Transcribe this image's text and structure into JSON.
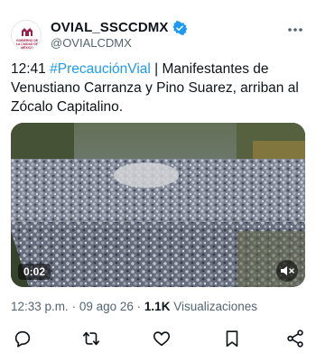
{
  "account": {
    "display_name": "OVIAL_SSCCDMX",
    "handle": "@OVIALCDMX",
    "logo_text": "GOBIERNO DE LA CIUDAD DE MÉXICO"
  },
  "tweet": {
    "time_prefix": "12:41 ",
    "hashtag": "#PrecauciónVial",
    "body": " | Manifestantes de Venustiano Carranza y Pino Suarez, arriban al Zócalo Capitalino."
  },
  "video": {
    "duration": "0:02"
  },
  "meta": {
    "posted_time": "12:33 p.m.",
    "separator": "·",
    "posted_date": "09 ago 26",
    "views_count": "1.1K",
    "views_label": "Visualizaciones"
  },
  "colors": {
    "accent": "#1d9bf0",
    "text": "#0f1419",
    "muted": "#536471",
    "brand": "#9b2247"
  },
  "icons": [
    "verified-icon",
    "more-icon",
    "mute-icon",
    "reply-icon",
    "retweet-icon",
    "like-icon",
    "bookmark-icon",
    "share-icon"
  ]
}
